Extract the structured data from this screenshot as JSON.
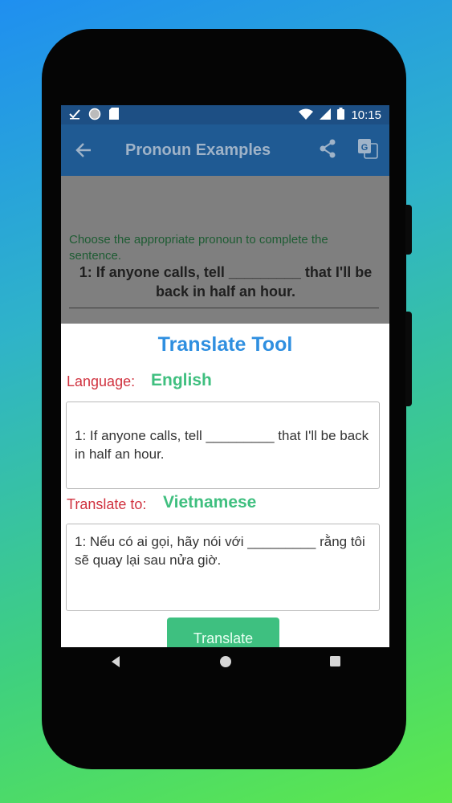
{
  "status_bar": {
    "time": "10:15"
  },
  "app_bar": {
    "title": "Pronoun Examples"
  },
  "content": {
    "instruction": "Choose the appropriate pronoun to complete the sentence.",
    "question": "1: If anyone calls, tell _________ that I'll be back in half an hour."
  },
  "dialog": {
    "title": "Translate Tool",
    "language_label": "Language:",
    "language_value": "English",
    "source_text": "1: If anyone calls, tell _________ that I'll be back in half an hour.",
    "translate_to_label": "Translate to:",
    "target_language": "Vietnamese",
    "translated_text": "1: Nếu có ai gọi, hãy nói với _________ rằng tôi sẽ quay lại sau nửa giờ.",
    "button_label": "Translate"
  },
  "colors": {
    "app_bar": "#1f5a93",
    "dialog_title": "#2f8fe0",
    "label_red": "#d0323f",
    "accent_green": "#3fbf7f"
  }
}
